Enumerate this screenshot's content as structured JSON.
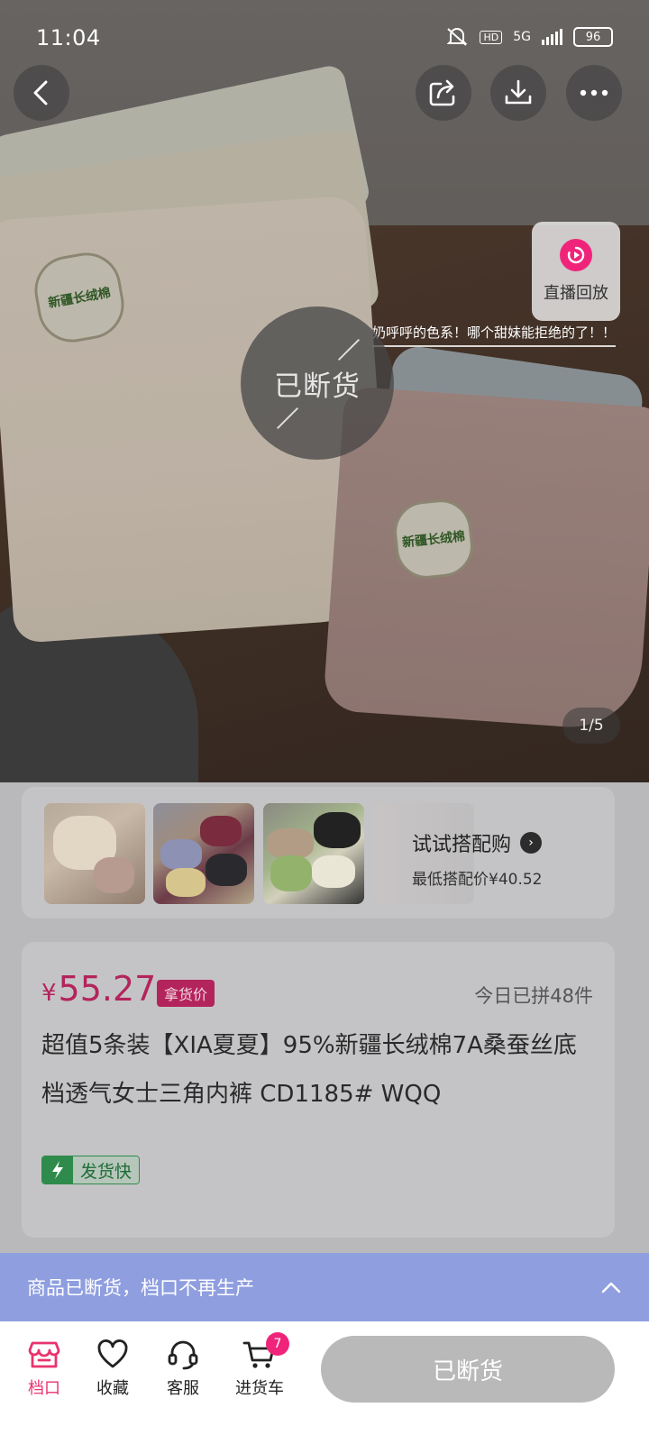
{
  "status_bar": {
    "time": "11:04",
    "network": "5G",
    "hd": "HD",
    "battery": "96"
  },
  "hero": {
    "sold_out_overlay": "已断货",
    "caption": "奶呼呼的色系！哪个甜妹能拒绝的了！！",
    "replay_label": "直播回放",
    "page_indicator": "1/5",
    "tag_text": "新疆长绒棉"
  },
  "combo": {
    "title": "试试搭配购",
    "subtitle": "最低搭配价¥40.52"
  },
  "product": {
    "price_symbol": "¥",
    "price": "55.27",
    "price_badge": "拿货价",
    "sold_today": "今日已拼48件",
    "title": "超值5条装【XIA夏夏】95%新疆长绒棉7A桑蚕丝底档透气女士三角内裤  CD1185# WQQ",
    "fast_ship": "发货快"
  },
  "notice": {
    "text": "商品已断货，档口不再生产"
  },
  "bottom_bar": {
    "tabs": [
      {
        "label": "档口",
        "icon": "shop-icon"
      },
      {
        "label": "收藏",
        "icon": "heart-icon"
      },
      {
        "label": "客服",
        "icon": "headset-icon"
      },
      {
        "label": "进货车",
        "icon": "cart-icon"
      }
    ],
    "cart_count": "7",
    "action_button": "已断货"
  },
  "colors": {
    "accent": "#f0237a",
    "price": "#b4245c",
    "notice": "#8c9ce0",
    "fast_ship": "#2f8b4b"
  }
}
